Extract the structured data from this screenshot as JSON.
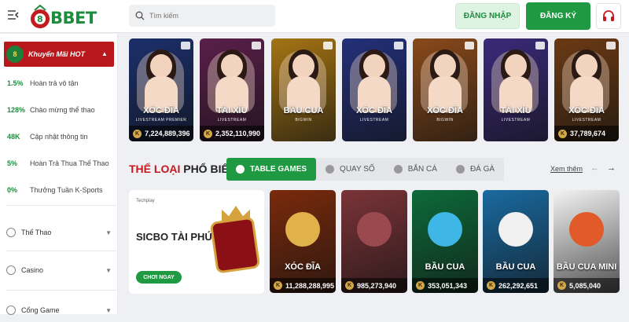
{
  "header": {
    "logo_text": "BBET",
    "search_placeholder": "Tìm kiếm",
    "login_label": "ĐĂNG NHẬP",
    "register_label": "ĐĂNG KÝ"
  },
  "sidebar": {
    "promo_title": "Khuyến Mãi HOT",
    "promos": [
      {
        "value": "1.5%",
        "label": "Hoàn trả vô tận"
      },
      {
        "value": "128%",
        "label": "Chào mừng thể thao"
      },
      {
        "value": "48K",
        "label": "Cập nhật thông tin"
      },
      {
        "value": "5%",
        "label": "Hoàn Trả Thua Thể Thao"
      },
      {
        "value": "0%",
        "label": "Thưởng Tuần K-Sports"
      }
    ],
    "nav": [
      {
        "label": "Thể Thao"
      },
      {
        "label": "Casino"
      },
      {
        "label": "Cổng Game"
      }
    ]
  },
  "live_cards": [
    {
      "title": "XÓC ĐĨA",
      "sub": "LIVESTREAM PREMIER",
      "amount": "7,224,889,396",
      "bg": "#1b2f6b"
    },
    {
      "title": "TÀI XỈU",
      "sub": "LIVESTREAM",
      "amount": "2,352,110,990",
      "bg": "#5a1f4a"
    },
    {
      "title": "BẦU CUA",
      "sub": "BIGWIN",
      "amount": "",
      "bg": "#a47413"
    },
    {
      "title": "XÓC ĐĨA",
      "sub": "LIVESTREAM",
      "amount": "",
      "bg": "#23307a"
    },
    {
      "title": "XÓC ĐĨA",
      "sub": "BIGWIN",
      "amount": "",
      "bg": "#8a4a1a"
    },
    {
      "title": "TÀI XỈU",
      "sub": "LIVESTREAM",
      "amount": "",
      "bg": "#3a2a7a"
    },
    {
      "title": "XÓC ĐĨA",
      "sub": "LIVESTREAM",
      "amount": "37,789,674",
      "bg": "#6b3a14"
    }
  ],
  "section": {
    "title_red": "THỂ LOẠI",
    "title_dark": "PHỔ BIẾN",
    "tabs": [
      "TABLE GAMES",
      "QUAY SỐ",
      "BẮN CÁ",
      "ĐÁ GÀ"
    ],
    "see_more": "Xem thêm",
    "prev": "←",
    "next": "→"
  },
  "featured": {
    "brand": "Techplay",
    "title": "SICBO TÀI PHÚ",
    "play_label": "CHƠI NGAY"
  },
  "game_cards": [
    {
      "title": "XÓC ĐĨA",
      "amount": "11,288,288,995",
      "bg": "#7a2a0c",
      "art": "#e2b24a"
    },
    {
      "title": "",
      "amount": "985,273,940",
      "bg": "#7a3438",
      "art": "#9a4a4e"
    },
    {
      "title": "BẦU CUA",
      "amount": "353,051,343",
      "bg": "#0e6a3a",
      "art": "#3fb7e6"
    },
    {
      "title": "BẦU CUA",
      "amount": "262,292,651",
      "bg": "#1a6aa0",
      "art": "#f0f0f0"
    },
    {
      "title": "BẦU CUA MINI",
      "amount": "5,085,040",
      "bg": "#f3f3f3",
      "art": "#e05a2a"
    }
  ]
}
